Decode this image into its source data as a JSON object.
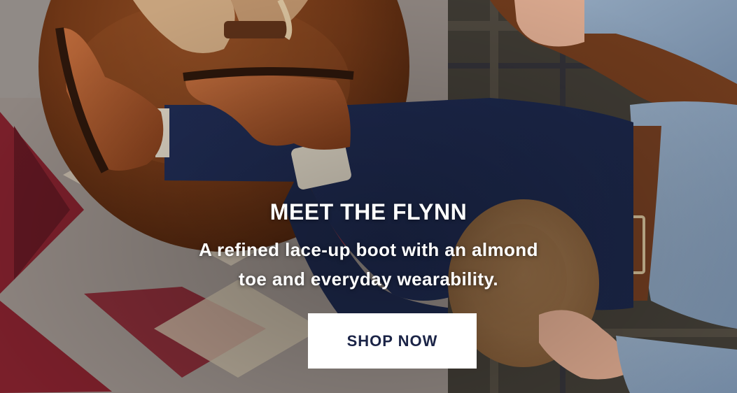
{
  "hero": {
    "heading": "MEET THE FLYNN",
    "subheading_line1": "A refined lace-up boot with an almond",
    "subheading_line2": "toe and everyday wearability.",
    "cta_label": "SHOP NOW"
  },
  "colors": {
    "cta_background": "#ffffff",
    "cta_text": "#1b2447",
    "heading_text": "#ffffff"
  }
}
